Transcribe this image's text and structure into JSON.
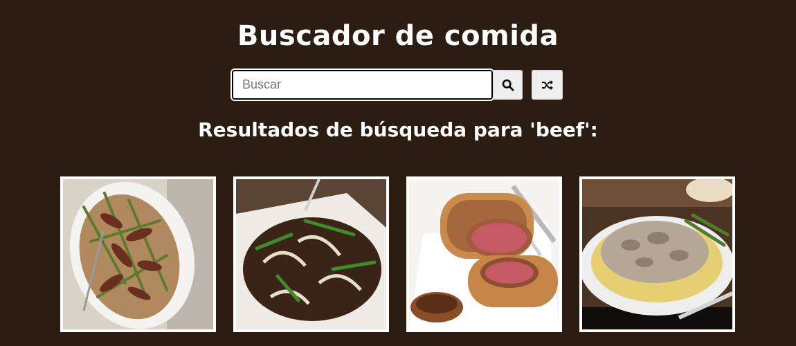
{
  "header": {
    "title": "Buscador de comida"
  },
  "search": {
    "placeholder": "Buscar",
    "value": "",
    "search_icon": "search-icon",
    "random_icon": "shuffle-icon"
  },
  "results": {
    "heading": "Resultados de búsqueda para 'beef':",
    "items": [
      {
        "image": "beef-asparagus-stir-fry-photo"
      },
      {
        "image": "mongolian-beef-onions-photo"
      },
      {
        "image": "beef-wellington-photo"
      },
      {
        "image": "beef-stroganoff-noodles-photo"
      }
    ]
  },
  "colors": {
    "background": "#2b1d12",
    "text": "#ffffff",
    "button": "#efefef"
  }
}
